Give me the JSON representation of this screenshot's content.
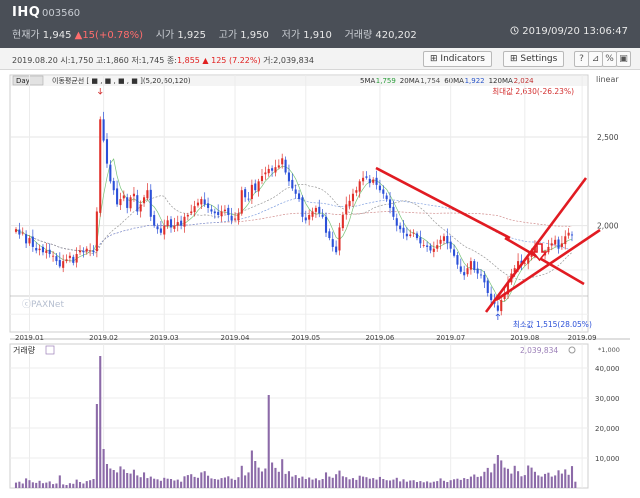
{
  "header": {
    "name": "IHQ",
    "code": "003560",
    "current_label": "현재가",
    "current_value": "1,945",
    "change": "▲15(+0.78%)",
    "open_label": "시가",
    "open_value": "1,925",
    "high_label": "고가",
    "high_value": "1,950",
    "low_label": "저가",
    "low_value": "1,910",
    "volume_label": "거래량",
    "volume_value": "420,202",
    "clock_icon": "clock-icon",
    "timestamp": "2019/09/20 13:06:47"
  },
  "toolbar": {
    "indicators_label": "Indicators",
    "settings_label": "Settings",
    "icons": [
      "help-icon",
      "chart-icon",
      "percent-icon",
      "save-icon",
      "print-icon"
    ]
  },
  "ohlc_line": {
    "date": "2019.08.20",
    "start": "시:1,750",
    "high": "고:1,860",
    "low": "저:1,745",
    "close_label": "종:",
    "close_value": "1,855",
    "change": "125",
    "pct": "7.22%",
    "volume": "거:2,039,834"
  },
  "chart_data": [
    {
      "type": "candlestick",
      "title": "IHQ 003560",
      "interval_label": "Day",
      "ma_title": "이동평균선 [ ■ , ■ , ■ , ■ ](5,20,60,120)",
      "scale_label": "linear",
      "x_tick_labels": [
        "2019.01",
        "2019.02",
        "2019.03",
        "2019.04",
        "2019.05",
        "2019.06",
        "2019.07",
        "2019.08",
        "2019.09"
      ],
      "y_tick_labels": [
        "2,500",
        "2,000"
      ],
      "ylim": [
        1400,
        2850
      ],
      "ma_legend": [
        {
          "name": "5MA",
          "value": "1,759",
          "color": "#2a9d3a"
        },
        {
          "name": "20MA",
          "value": "1,754",
          "color": "#555555"
        },
        {
          "name": "60MA",
          "value": "1,922",
          "color": "#2a55c8"
        },
        {
          "name": "120MA",
          "value": "2,024",
          "color": "#c03030"
        }
      ],
      "max_label": "최대값 2,630(-26.23%)",
      "min_label": "최소값 1,515(28.05%)",
      "close_series": [
        1980,
        1950,
        1960,
        1900,
        1930,
        1880,
        1860,
        1870,
        1850,
        1860,
        1840,
        1830,
        1800,
        1770,
        1800,
        1810,
        1830,
        1790,
        1840,
        1860,
        1850,
        1870,
        1860,
        1850,
        2080,
        2600,
        2480,
        2350,
        2250,
        2200,
        2120,
        2150,
        2170,
        2100,
        2160,
        2180,
        2080,
        2120,
        2160,
        2200,
        2050,
        2000,
        1980,
        1960,
        2000,
        2030,
        1990,
        2000,
        2020,
        2000,
        2050,
        2060,
        2080,
        2110,
        2130,
        2150,
        2120,
        2100,
        2080,
        2070,
        2060,
        2080,
        2090,
        2060,
        2030,
        2040,
        2070,
        2200,
        2160,
        2150,
        2230,
        2200,
        2250,
        2280,
        2300,
        2320,
        2310,
        2330,
        2340,
        2380,
        2300,
        2250,
        2210,
        2180,
        2150,
        2050,
        2030,
        2060,
        2080,
        2100,
        2070,
        2050,
        1960,
        1930,
        1880,
        1850,
        1990,
        2060,
        2120,
        2140,
        2180,
        2200,
        2250,
        2270,
        2270,
        2240,
        2260,
        2230,
        2200,
        2180,
        2150,
        2100,
        2050,
        2000,
        1980,
        1960,
        1940,
        1950,
        1960,
        1930,
        1900,
        1890,
        1880,
        1860,
        1870,
        1890,
        1920,
        1940,
        1900,
        1870,
        1830,
        1780,
        1740,
        1720,
        1760,
        1800,
        1750,
        1730,
        1720,
        1680,
        1620,
        1580,
        1560,
        1520,
        1580,
        1620,
        1680,
        1730,
        1760,
        1800,
        1780,
        1790,
        1820,
        1860,
        1880,
        1870,
        1840,
        1850,
        1880,
        1900,
        1920,
        1870,
        1900,
        1940,
        1960,
        1945
      ]
    },
    {
      "type": "bar",
      "title": "거래량",
      "volume_label": "2,039,834",
      "unit_label": "*1,000",
      "y_tick_labels": [
        "40,000",
        "30,000",
        "20,000",
        "10,000"
      ],
      "ylim": [
        0,
        48000
      ],
      "highlight": {
        "day_index": 25,
        "value": 44000
      },
      "secondary_peaks": [
        {
          "day_index": 24,
          "value": 28000
        },
        {
          "day_index": 74,
          "value": 31000
        }
      ],
      "values_thousands": [
        1800,
        2100,
        1500,
        3200,
        2600,
        1900,
        1700,
        2400,
        1600,
        1800,
        2200,
        1300,
        1500,
        4200,
        1200,
        1000,
        1600,
        1400,
        2800,
        2000,
        1500,
        2300,
        2600,
        3000,
        28000,
        44000,
        13000,
        8000,
        6500,
        6000,
        5200,
        7200,
        6200,
        5000,
        4800,
        6100,
        4200,
        3600,
        5200,
        3300,
        3800,
        3100,
        2900,
        2400,
        3400,
        3100,
        3000,
        2500,
        2800,
        2100,
        3900,
        4300,
        4600,
        3700,
        3400,
        5200,
        5600,
        4100,
        3200,
        3000,
        2800,
        3300,
        3500,
        3900,
        3100,
        2700,
        3600,
        7400,
        4200,
        5200,
        12500,
        9000,
        6800,
        5500,
        6500,
        31000,
        8500,
        6700,
        5400,
        9600,
        4700,
        5600,
        3800,
        4300,
        3300,
        3800,
        3000,
        3500,
        2800,
        3200,
        2600,
        3000,
        5200,
        3800,
        3400,
        4600,
        5800,
        3900,
        3600,
        2900,
        3300,
        2700,
        4100,
        3800,
        3600,
        3100,
        3300,
        2800,
        3700,
        3000,
        2600,
        2500,
        2800,
        3400,
        2200,
        2900,
        2100,
        2500,
        2600,
        2000,
        2300,
        1900,
        2200,
        1800,
        2100,
        2300,
        3200,
        2400,
        2000,
        2600,
        2900,
        3100,
        2700,
        3300,
        3000,
        3800,
        4500,
        3700,
        3900,
        5400,
        6700,
        5200,
        8100,
        11000,
        9200,
        6800,
        6400,
        4800,
        7400,
        5600,
        3900,
        4300,
        7500,
        6800,
        5400,
        4200,
        3800,
        4700,
        5100,
        3800,
        4200,
        5900,
        4800,
        6200,
        4400,
        7300,
        2100
      ]
    }
  ],
  "annotations": {
    "copyright": "ⓒPAXNet"
  }
}
